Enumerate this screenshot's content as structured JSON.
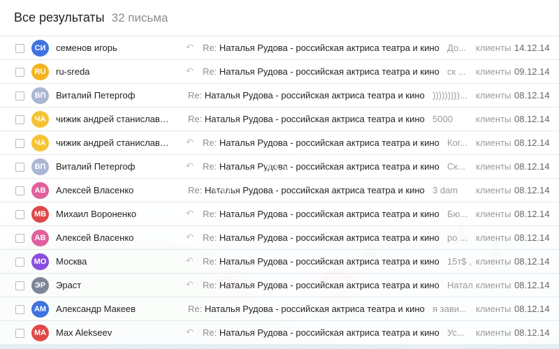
{
  "header": {
    "title": "Все результаты",
    "count": "32 письма"
  },
  "watermark": "mssoft.cn",
  "rows": [
    {
      "avatar": "СИ",
      "color": "#3f73e0",
      "sender": "семенов игорь",
      "reply": true,
      "re": "Re:",
      "subject": "Наталья Рудова - российская актриса театра и кино",
      "snippet": "До...",
      "folder": "клиенты",
      "date": "14.12.14"
    },
    {
      "avatar": "RU",
      "color": "#f2b420",
      "sender": "ru-sreda",
      "reply": true,
      "re": "Re:",
      "subject": "Наталья Рудова - российская актриса театра и кино",
      "snippet": "ск ...",
      "folder": "клиенты",
      "date": "09.12.14"
    },
    {
      "avatar": "ВП",
      "color": "#a9b6d4",
      "sender": "Виталий Петергоф",
      "reply": false,
      "re": "Re:",
      "subject": "Наталья Рудова - российская актриса театра и кино",
      "snippet": ")))))))))...",
      "folder": "клиенты",
      "date": "08.12.14"
    },
    {
      "avatar": "ЧА",
      "color": "#f5c231",
      "sender": "чижик андрей станиславович",
      "reply": false,
      "re": "Re:",
      "subject": "Наталья Рудова - российская актриса театра и кино",
      "snippet": "5000",
      "folder": "клиенты",
      "date": "08.12.14"
    },
    {
      "avatar": "ЧА",
      "color": "#f5c231",
      "sender": "чижик андрей станиславович",
      "reply": true,
      "re": "Re:",
      "subject": "Наталья Рудова - российская актриса театра и кино",
      "snippet": "Ког...",
      "folder": "клиенты",
      "date": "08.12.14"
    },
    {
      "avatar": "ВП",
      "color": "#a9b6d4",
      "sender": "Виталий Петергоф",
      "reply": true,
      "re": "Re:",
      "subject": "Наталья Рудова - российская актриса театра и кино",
      "snippet": "Ск...",
      "folder": "клиенты",
      "date": "08.12.14"
    },
    {
      "avatar": "АВ",
      "color": "#e0609e",
      "sender": "Алексей Власенко",
      "reply": false,
      "re": "Re:",
      "subject": "Наталья Рудова - российская актриса театра и кино",
      "snippet": "3 dam",
      "folder": "клиенты",
      "date": "08.12.14"
    },
    {
      "avatar": "МВ",
      "color": "#e04848",
      "sender": "Михаил Вороненко",
      "reply": true,
      "re": "Re:",
      "subject": "Наталья Рудова - российская актриса театра и кино",
      "snippet": "Бю...",
      "folder": "клиенты",
      "date": "08.12.14"
    },
    {
      "avatar": "АВ",
      "color": "#e0609e",
      "sender": "Алексей Власенко",
      "reply": true,
      "re": "Re:",
      "subject": "Наталья Рудова - российская актриса театра и кино",
      "snippet": "ро ...",
      "folder": "клиенты",
      "date": "08.12.14"
    },
    {
      "avatar": "МО",
      "color": "#8a4fe0",
      "sender": "Москва",
      "reply": true,
      "re": "Re:",
      "subject": "Наталья Рудова - российская актриса театра и кино",
      "snippet": "15т$ ,",
      "folder": "клиенты",
      "date": "08.12.14"
    },
    {
      "avatar": "ЭР",
      "color": "#7e8596",
      "sender": "Эраст",
      "reply": true,
      "re": "Re:",
      "subject": "Наталья Рудова - российская актриса театра и кино",
      "snippet": "Натал...",
      "folder": "клиенты",
      "date": "08.12.14"
    },
    {
      "avatar": "АМ",
      "color": "#3f73e0",
      "sender": "Александр Макеев",
      "reply": false,
      "re": "Re:",
      "subject": "Наталья Рудова - российская актриса театра и кино",
      "snippet": "я зави...",
      "folder": "клиенты",
      "date": "08.12.14"
    },
    {
      "avatar": "МА",
      "color": "#e04848",
      "sender": "Max Alekseev",
      "reply": true,
      "re": "Re:",
      "subject": "Наталья Рудова - российская актриса театра и кино",
      "snippet": "Ус...",
      "folder": "клиенты",
      "date": "08.12.14"
    }
  ]
}
